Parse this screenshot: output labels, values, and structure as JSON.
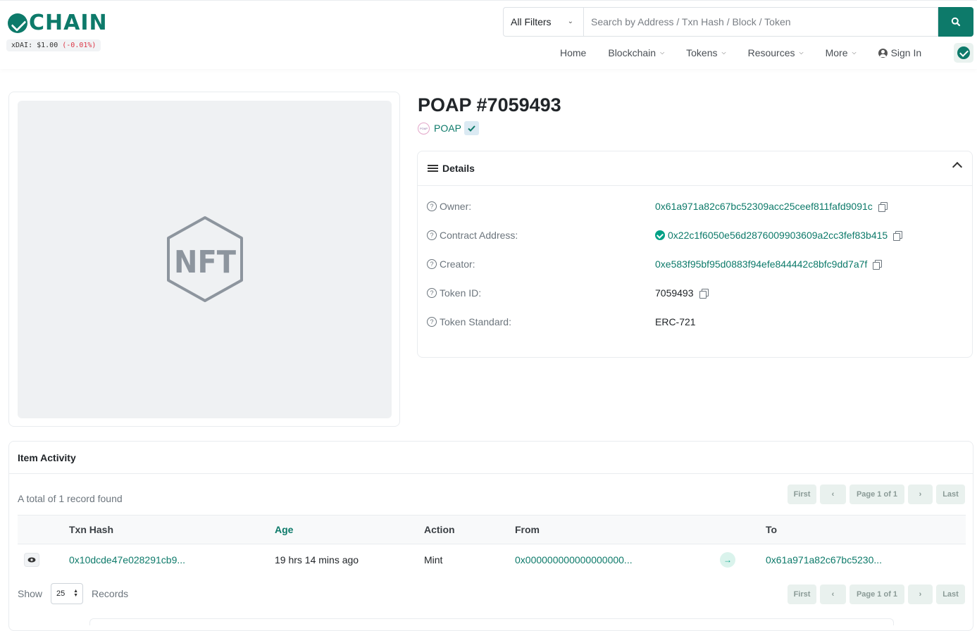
{
  "header": {
    "logo_text": "CHAIN",
    "price_label": "xDAI: $1.00",
    "price_change": "(-0.01%)",
    "filter_selected": "All Filters",
    "search_placeholder": "Search by Address / Txn Hash / Block / Token",
    "nav": {
      "home": "Home",
      "blockchain": "Blockchain",
      "tokens": "Tokens",
      "resources": "Resources",
      "more": "More",
      "sign_in": "Sign In"
    }
  },
  "token": {
    "image_placeholder": "NFT",
    "title": "POAP #7059493",
    "collection_logo_text": "POAP",
    "collection_name": "POAP"
  },
  "details": {
    "heading": "Details",
    "rows": [
      {
        "label": "Owner:",
        "value": "0x61a971a82c67bc52309acc25ceef811fafd9091c"
      },
      {
        "label": "Contract Address:",
        "value": "0x22c1f6050e56d2876009903609a2cc3fef83b415"
      },
      {
        "label": "Creator:",
        "value": "0xe583f95bf95d0883f94efe844442c8bfc9dd7a7f"
      },
      {
        "label": "Token ID:",
        "value": "7059493"
      },
      {
        "label": "Token Standard:",
        "value": "ERC-721"
      }
    ]
  },
  "activity": {
    "heading": "Item Activity",
    "total_text": "A total of 1 record found",
    "pager": {
      "first": "First",
      "page": "Page 1 of 1",
      "last": "Last"
    },
    "columns": {
      "txn_hash": "Txn Hash",
      "age": "Age",
      "action": "Action",
      "from": "From",
      "to": "To"
    },
    "rows": [
      {
        "txn_hash": "0x10dcde47e028291cb9...",
        "age": "19 hrs 14 mins ago",
        "action": "Mint",
        "from": "0x000000000000000000...",
        "to": "0x61a971a82c67bc5230..."
      }
    ],
    "show_label": "Show",
    "page_size": "25",
    "records_label": "Records"
  }
}
